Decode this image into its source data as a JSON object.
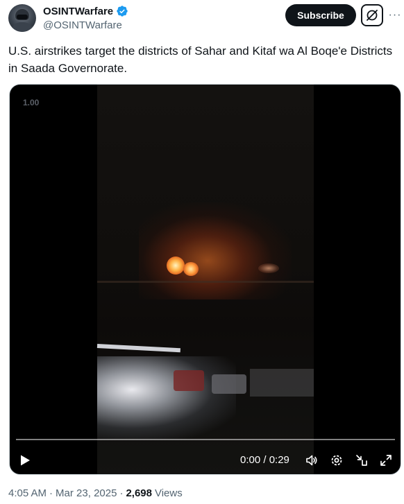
{
  "author": {
    "display_name": "OSINTWarfare",
    "handle": "@OSINTWarfare",
    "verified_icon": "verified-badge-icon",
    "verified_color": "#1d9bf0"
  },
  "actions": {
    "subscribe_label": "Subscribe",
    "grok_icon": "grok-icon",
    "more_icon": "more-horizontal-icon",
    "more_label": "···"
  },
  "tweet": {
    "text": "U.S. airstrikes target the districts of Sahar and Kitaf wa Al Boqe'e Districts in Saada Governorate."
  },
  "video": {
    "speed_label": "1.00",
    "progress": 0.0,
    "time_label": "0:00 / 0:29",
    "icons": [
      "play-icon",
      "volume-icon",
      "settings-icon",
      "pip-icon",
      "fullscreen-icon"
    ],
    "accent": "#1d9bf0"
  },
  "footer": {
    "time": "4:05 AM",
    "separator": "·",
    "date": "Mar 23, 2025",
    "views_count": "2,698",
    "views_label": "Views"
  }
}
